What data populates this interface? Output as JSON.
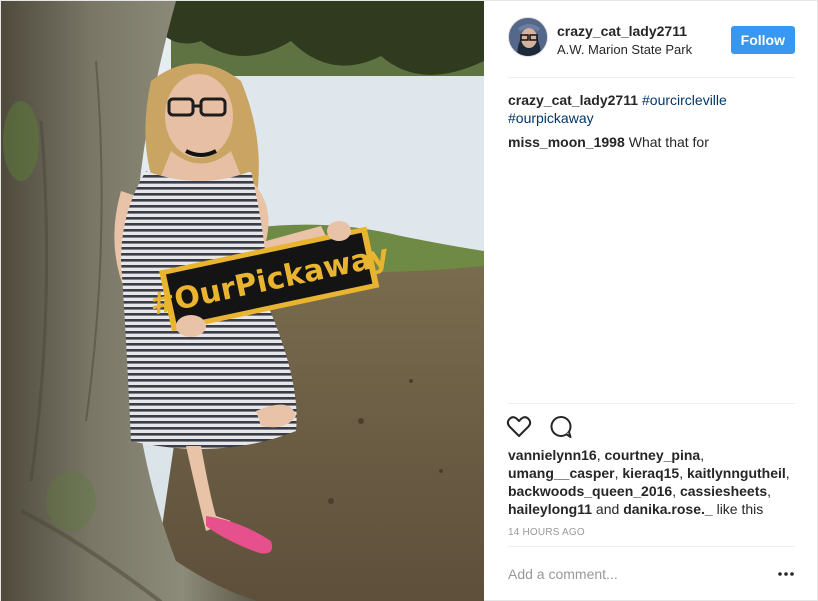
{
  "photo": {
    "sign_text": "#OurPickaway"
  },
  "header": {
    "username": "crazy_cat_lady2711",
    "location": "A.W. Marion State Park",
    "follow_label": "Follow"
  },
  "comments": [
    {
      "user": "crazy_cat_lady2711",
      "tags": [
        "#ourcircleville",
        "#ourpickaway"
      ]
    },
    {
      "user": "miss_moon_1998",
      "text": "What that for"
    }
  ],
  "actions": {
    "like_icon": "heart-icon",
    "comment_icon": "comment-icon"
  },
  "likes": {
    "users": [
      "vannielynn16",
      "courtney_pina",
      "umang__casper",
      "kieraq15",
      "kaitlynngutheil",
      "backwoods_queen_2016",
      "cassiesheets",
      "haileylong11",
      "danika.rose._"
    ],
    "sep": ", ",
    "and": " and ",
    "suffix": " like this"
  },
  "timestamp": "14 HOURS AGO",
  "add_comment": {
    "placeholder": "Add a comment...",
    "more_icon": "more-options-icon"
  },
  "colors": {
    "follow_button": "#3897f0",
    "hashtag": "#003569",
    "sign_text": "#e9b530",
    "sign_board": "#141414"
  }
}
